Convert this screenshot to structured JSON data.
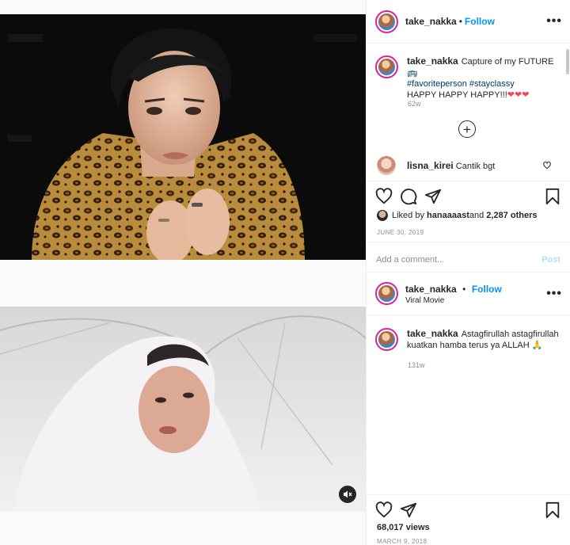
{
  "post1": {
    "header": {
      "username": "take_nakka",
      "separator": "•",
      "follow_label": "Follow",
      "more_label": "•••"
    },
    "caption": {
      "username": "take_nakka",
      "text": "Capture of my FUTURE",
      "hashtag1": "#favoriteperson",
      "hashtag2": "#stayclassy",
      "line3": "HAPPY HAPPY HAPPY!!!",
      "hearts": "❤❤❤",
      "time": "62w"
    },
    "load_more_label": "+",
    "comment": {
      "username": "lisna_kirei",
      "text": "Cantik bgt",
      "like_icon": "heart-outline"
    },
    "likes": {
      "prefix": "Liked by ",
      "user": "hanaaaast",
      "middle": " and ",
      "count": "2,287 others"
    },
    "date": "JUNE 30, 2019",
    "add_comment": {
      "placeholder": "Add a comment...",
      "post_label": "Post"
    }
  },
  "post2": {
    "header": {
      "username": "take_nakka",
      "separator": "•",
      "follow_label": "Follow",
      "subtitle": "Viral Movie",
      "more_label": "•••"
    },
    "caption": {
      "username": "take_nakka",
      "line1": "Astagfirullah astagfirullah",
      "line2": "kuatkan hamba terus ya ALLAH",
      "emoji": "🙏",
      "time": "131w"
    },
    "views": "68,017 views",
    "date": "MARCH 9, 2018"
  },
  "colors": {
    "link": "#0095f6",
    "muted": "#8e8e8e",
    "hashtag": "#00376b",
    "heart": "#ed4956"
  }
}
